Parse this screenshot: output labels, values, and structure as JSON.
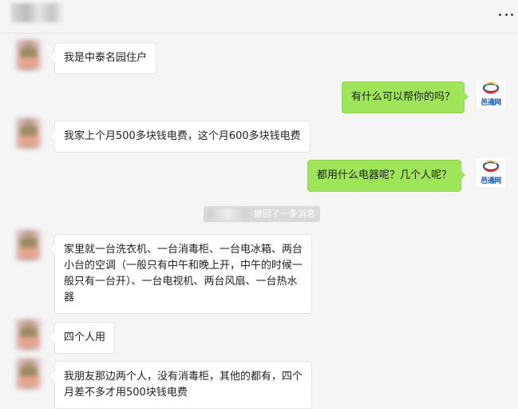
{
  "header": {
    "title_blurred": true,
    "more_icon": "more-icon"
  },
  "messages": [
    {
      "side": "left",
      "avatar": "blurred-user-avatar",
      "text": "我是中泰名园住户"
    },
    {
      "side": "right",
      "avatar": "site-logo-avatar",
      "text": "有什么可以帮你的吗？"
    },
    {
      "side": "left",
      "avatar": "blurred-user-avatar",
      "text": "我家上个月500多块钱电费，这个月600多块钱电费"
    },
    {
      "side": "right",
      "avatar": "site-logo-avatar",
      "text": "都用什么电器呢？几个人呢？"
    },
    {
      "side": "left",
      "avatar": "blurred-user-avatar",
      "text": "家里就一台洗衣机、一台消毒柜、一台电冰箱、两台\n小台的空调（一般只有中午和晚上开，中午的时候一\n般只有一台开）、一台电视机、两台风扇、一台热水\n器"
    },
    {
      "side": "left",
      "avatar": "blurred-user-avatar",
      "text": "四个人用"
    },
    {
      "side": "left",
      "avatar": "blurred-user-avatar",
      "text": "我朋友那边两个人，没有消毒柜，其他的都有，四个\n月差不多才用500块钱电费"
    }
  ],
  "system_notice": "撤回了一条消息",
  "logo": {
    "text": "邑通网",
    "colors": {
      "blue": "#1d5aa8",
      "red": "#d9302b",
      "yellow": "#f2b51e"
    }
  },
  "colors": {
    "background": "#f5f5f5",
    "left_bubble": "#ffffff",
    "right_bubble": "#9ee55a"
  }
}
